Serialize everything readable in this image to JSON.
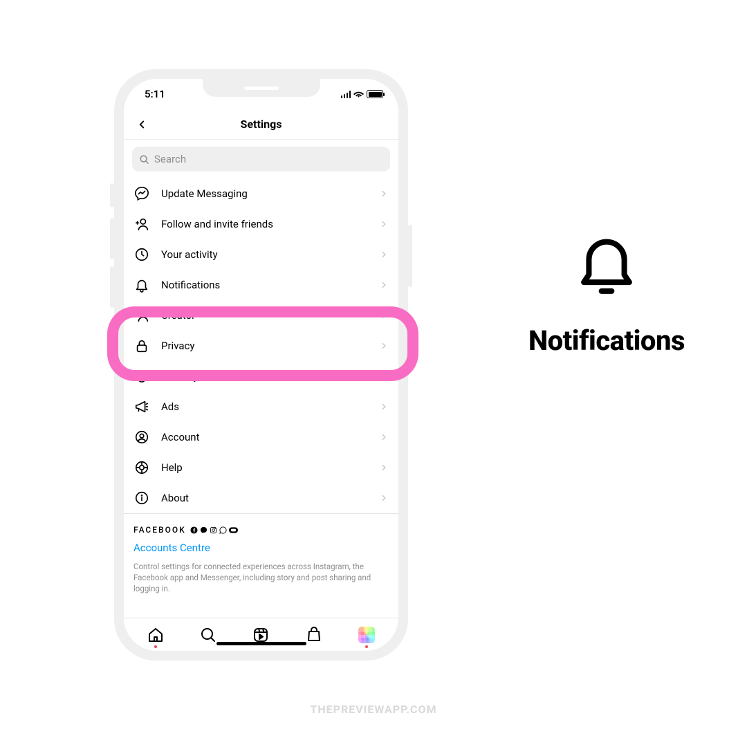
{
  "status": {
    "time": "5:11"
  },
  "header": {
    "title": "Settings"
  },
  "search": {
    "placeholder": "Search"
  },
  "items": [
    {
      "label": "Update Messaging"
    },
    {
      "label": "Follow and invite friends"
    },
    {
      "label": "Your activity"
    },
    {
      "label": "Notifications"
    },
    {
      "label": "Creator"
    },
    {
      "label": "Privacy"
    },
    {
      "label": "Security"
    },
    {
      "label": "Ads"
    },
    {
      "label": "Account"
    },
    {
      "label": "Help"
    },
    {
      "label": "About"
    }
  ],
  "footer": {
    "brand": "FACEBOOK",
    "link": "Accounts Centre",
    "desc": "Control settings for connected experiences across Instagram, the Facebook app and Messenger, including story and post sharing and logging in."
  },
  "callout": {
    "title": "Notifications"
  },
  "watermark": "THEPREVIEWAPP.COM"
}
